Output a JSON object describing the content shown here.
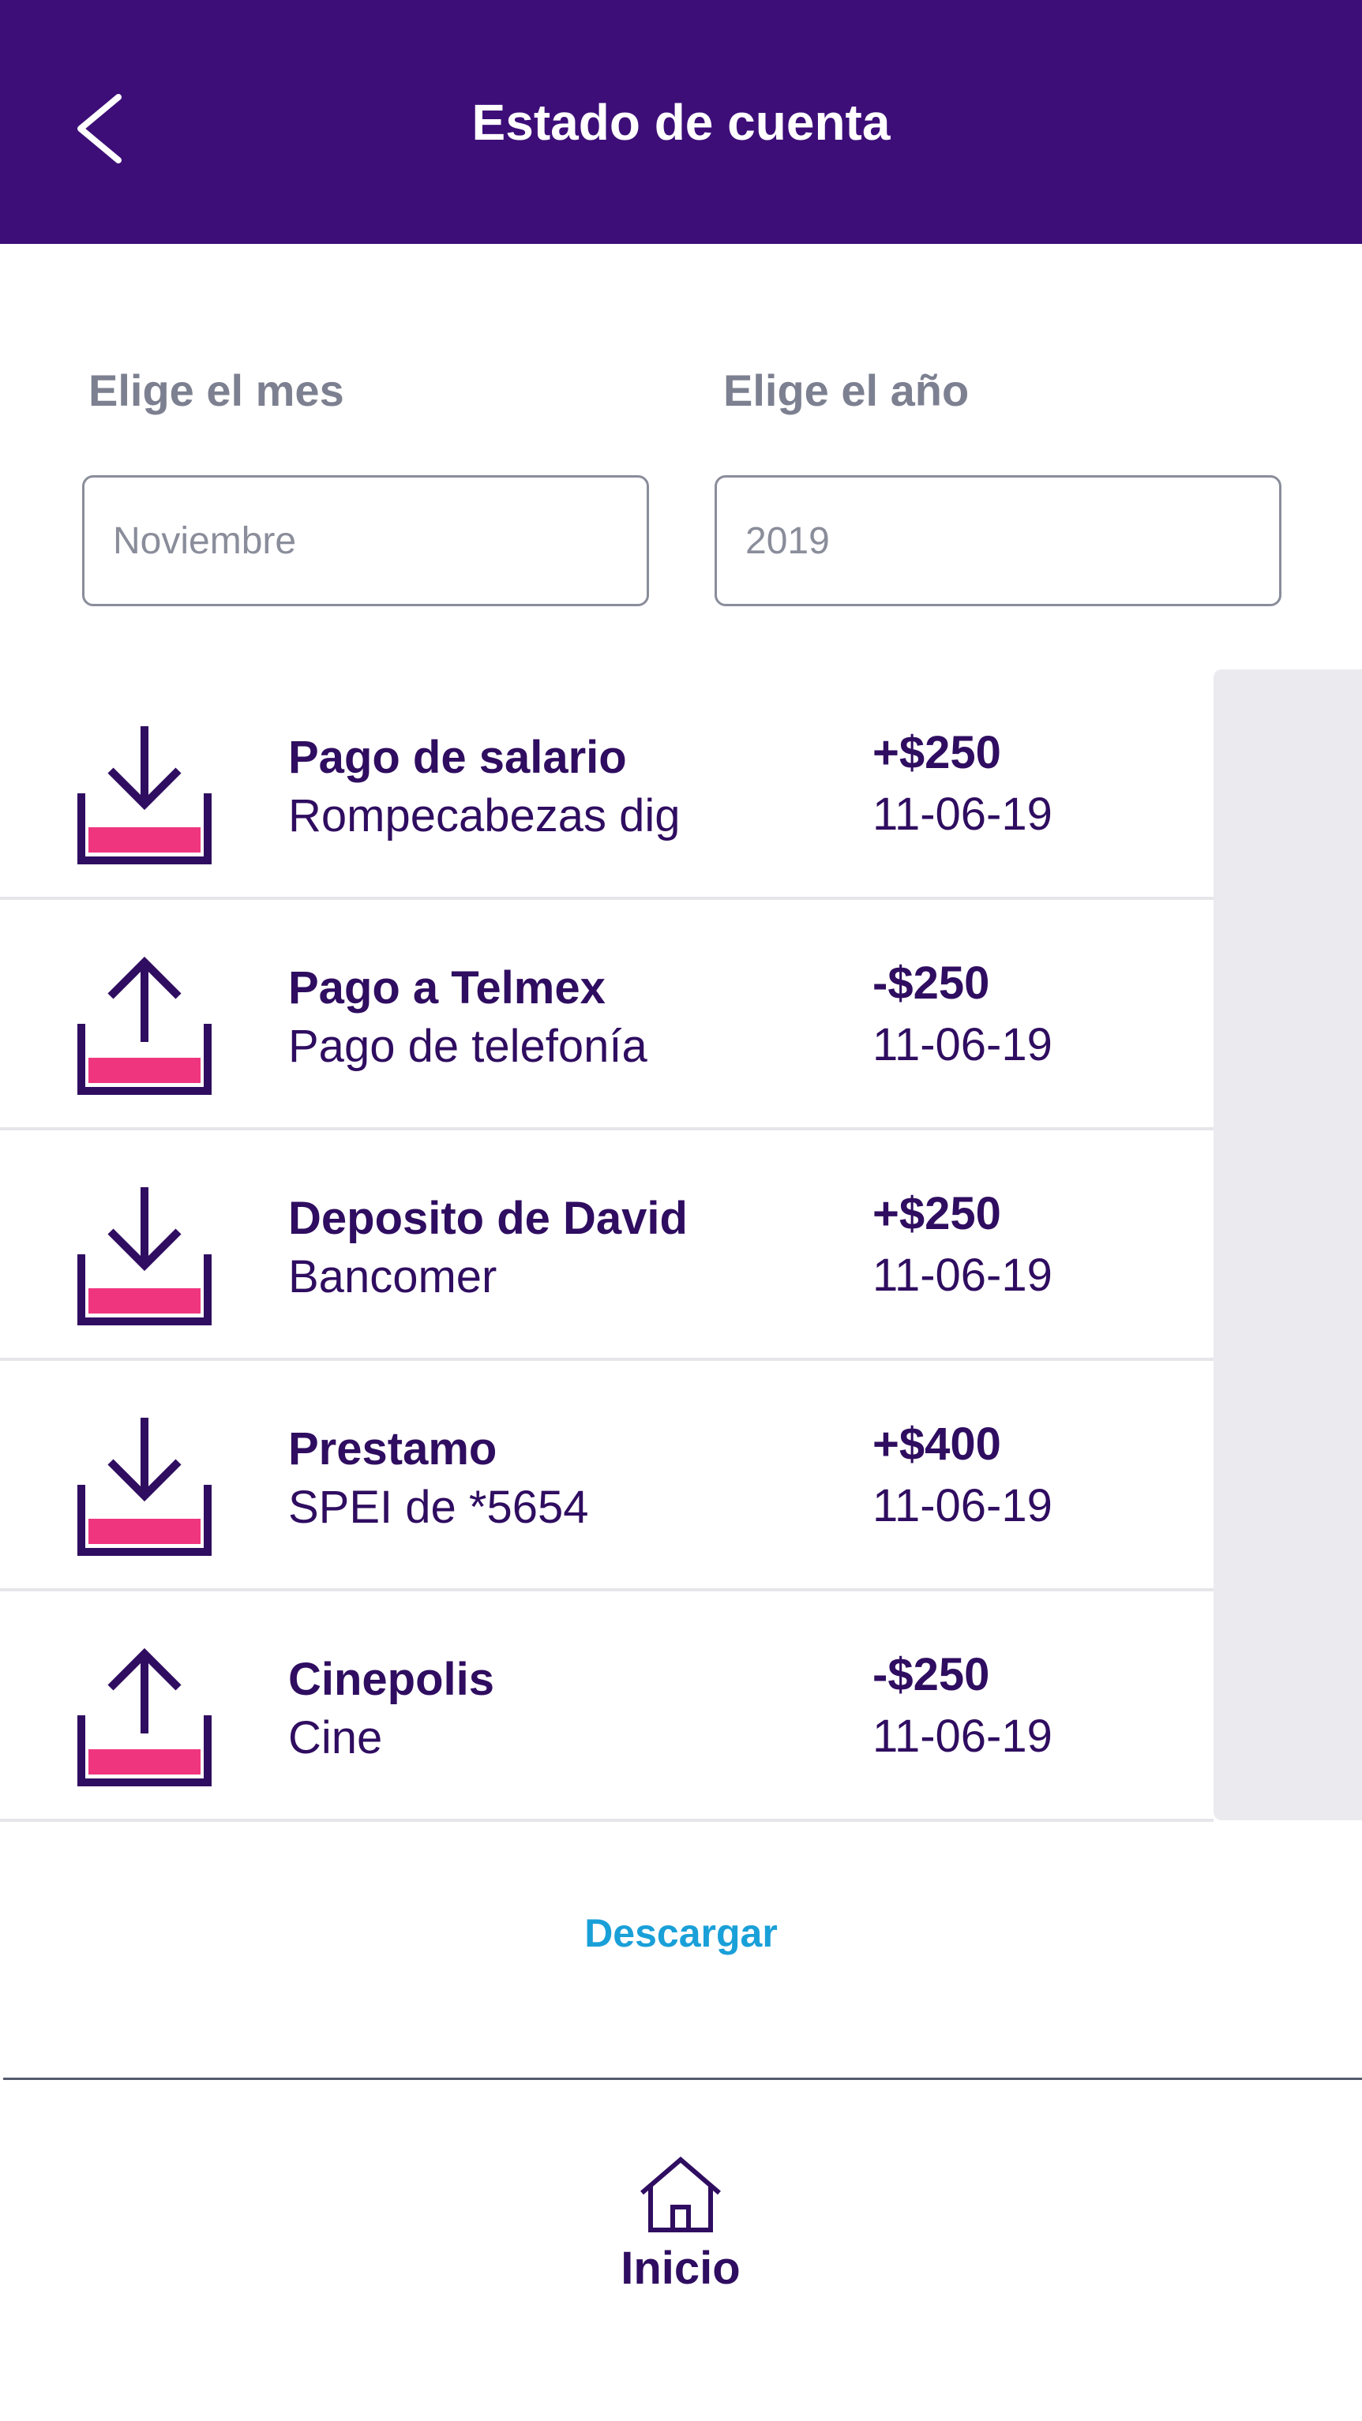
{
  "header": {
    "title": "Estado de cuenta",
    "back_icon": "chevron-left-icon"
  },
  "filters": {
    "month": {
      "label": "Elige el mes",
      "value": "Noviembre"
    },
    "year": {
      "label": "Elige el año",
      "value": "2019"
    }
  },
  "transactions": [
    {
      "type": "incoming",
      "icon": "download-icon",
      "title": "Pago de salario",
      "subtitle": "Rompecabezas dig",
      "amount": "+$250",
      "date": "11-06-19"
    },
    {
      "type": "outgoing",
      "icon": "upload-icon",
      "title": "Pago a Telmex",
      "subtitle": "Pago de telefonía",
      "amount": "-$250",
      "date": "11-06-19"
    },
    {
      "type": "incoming",
      "icon": "download-icon",
      "title": "Deposito de David",
      "subtitle": "Bancomer",
      "amount": "+$250",
      "date": "11-06-19"
    },
    {
      "type": "incoming",
      "icon": "download-icon",
      "title": "Prestamo",
      "subtitle": "SPEI de *5654",
      "amount": "+$400",
      "date": "11-06-19"
    },
    {
      "type": "outgoing",
      "icon": "upload-icon",
      "title": "Cinepolis",
      "subtitle": "Cine",
      "amount": "-$250",
      "date": "11-06-19"
    }
  ],
  "actions": {
    "download_label": "Descargar"
  },
  "bottom_nav": {
    "home_label": "Inicio",
    "home_icon": "home-icon"
  },
  "colors": {
    "header_bg": "#3d0e78",
    "text_primary": "#2f0d60",
    "accent_pink": "#f0357f",
    "link_blue": "#1aa0d8"
  }
}
